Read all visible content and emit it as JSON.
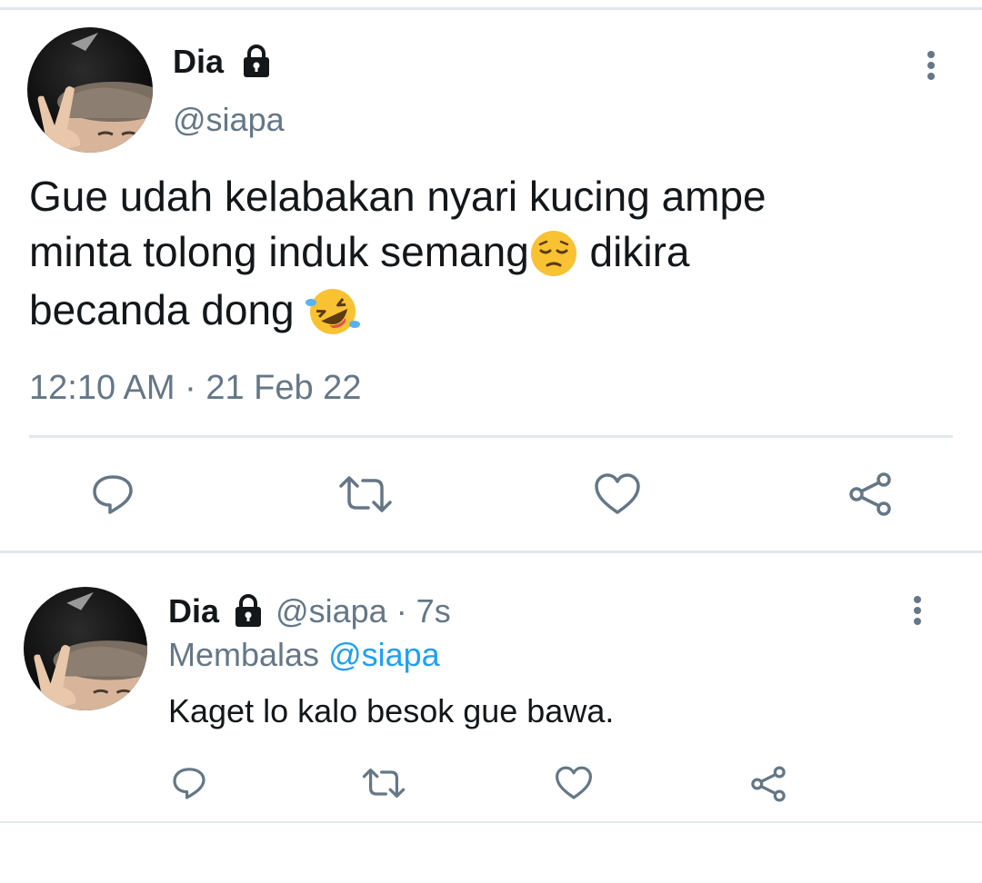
{
  "main_tweet": {
    "author_name": "Dia",
    "handle": "@siapa",
    "text_line1": "Gue udah kelabakan nyari kucing ampe",
    "text_line2_before": "minta tolong induk semang",
    "text_line2_after": " dikira",
    "text_line3": "becanda dong ",
    "timestamp": "12:10 AM · 21 Feb 22",
    "actions": [
      "reply-icon",
      "retweet-icon",
      "like-icon",
      "share-icon"
    ]
  },
  "reply_tweet": {
    "author_name": "Dia",
    "handle": "@siapa",
    "time": "· 7s",
    "replying_prefix": "Membalas",
    "replying_to": "@siapa",
    "text": "Kaget lo kalo besok gue bawa.",
    "actions": [
      "reply-icon",
      "retweet-icon",
      "like-icon",
      "share-icon"
    ]
  },
  "colors": {
    "text": "#14171a",
    "muted": "#657786",
    "link": "#1da1f2",
    "divider": "#e1e8ed"
  }
}
